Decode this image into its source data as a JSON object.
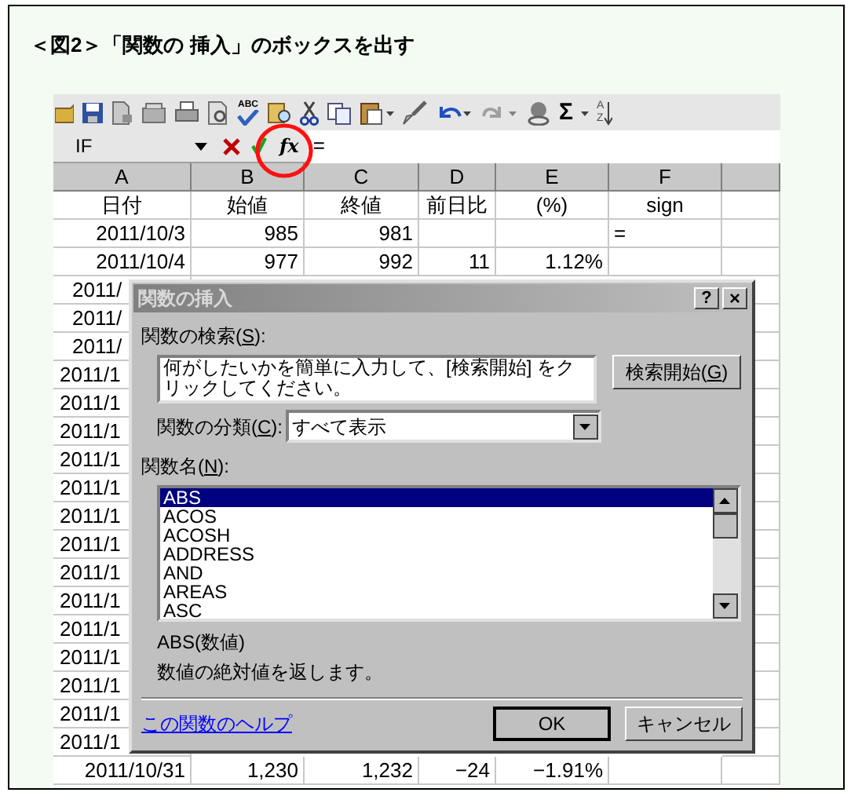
{
  "heading": "＜図2＞「関数の 挿入」のボックスを出す",
  "toolbar": {
    "spell_label": "ABC",
    "sum_label": "Σ",
    "sort_labels": [
      "A",
      "Z"
    ]
  },
  "formula_bar": {
    "name_box": "IF",
    "function_label": "fx",
    "formula": "=",
    "highlight_circle": true
  },
  "columns": [
    "A",
    "B",
    "C",
    "D",
    "E",
    "F",
    ""
  ],
  "rows": [
    [
      "日付",
      "始値",
      "終値",
      "前日比",
      "(%)",
      "sign"
    ],
    [
      "2011/10/3",
      "985",
      "981",
      "",
      "",
      "="
    ],
    [
      "2011/10/4",
      "977",
      "992",
      "11",
      "1.12%",
      ""
    ],
    [
      "2011/"
    ],
    [
      "2011/"
    ],
    [
      "2011/"
    ],
    [
      "2011/1"
    ],
    [
      "2011/1"
    ],
    [
      "2011/1"
    ],
    [
      "2011/1"
    ],
    [
      "2011/1"
    ],
    [
      "2011/1"
    ],
    [
      "2011/1"
    ],
    [
      "2011/1"
    ],
    [
      "2011/1"
    ],
    [
      "2011/1"
    ],
    [
      "2011/1"
    ],
    [
      "2011/1"
    ],
    [
      "2011/1"
    ],
    [
      "2011/1"
    ],
    [
      "2011/10/31",
      "1,230",
      "1,232",
      "−24",
      "−1.91%",
      ""
    ]
  ],
  "dialog": {
    "title": "関数の挿入",
    "help_button": "?",
    "close_button": "×",
    "search_label": [
      "関数の検索(",
      "S",
      "):"
    ],
    "search_text": "何がしたいかを簡単に入力して、[検索開始] をクリックしてください。",
    "search_button": [
      "検索開始(",
      "G",
      ")"
    ],
    "category_label": [
      "関数の分類(",
      "C",
      "):"
    ],
    "category_value": "すべて表示",
    "list_label": [
      "関数名(",
      "N",
      "):"
    ],
    "functions": [
      {
        "name": "ABS",
        "selected": true
      },
      {
        "name": "ACOS",
        "selected": false
      },
      {
        "name": "ACOSH",
        "selected": false
      },
      {
        "name": "ADDRESS",
        "selected": false
      },
      {
        "name": "AND",
        "selected": false
      },
      {
        "name": "AREAS",
        "selected": false
      },
      {
        "name": "ASC",
        "selected": false
      }
    ],
    "syntax": "ABS(数値)",
    "description": "数値の絶対値を返します。",
    "help_link": "この関数のヘルプ",
    "ok_button": "OK",
    "cancel_button": "キャンセル"
  }
}
